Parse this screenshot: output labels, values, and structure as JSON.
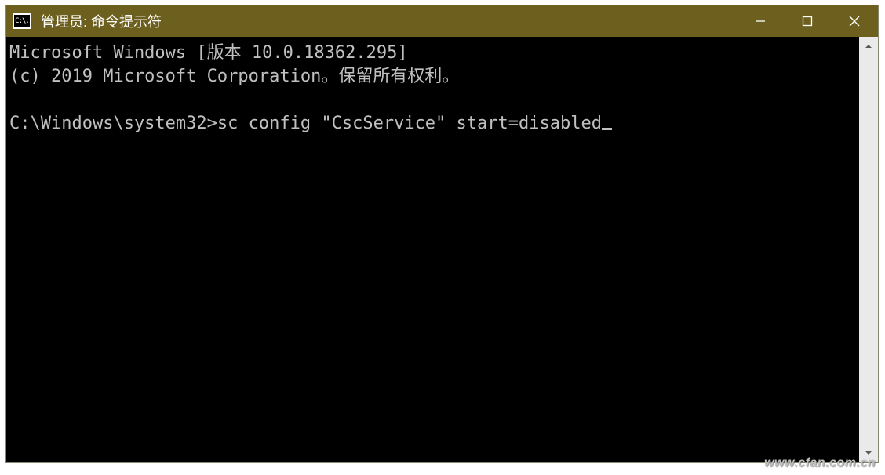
{
  "window": {
    "icon_text": "C:\\.",
    "title": "管理员: 命令提示符"
  },
  "terminal": {
    "line1": "Microsoft Windows [版本 10.0.18362.295]",
    "line2": "(c) 2019 Microsoft Corporation。保留所有权利。",
    "blank": "",
    "prompt": "C:\\Windows\\system32>",
    "command": "sc config \"CscService\" start=disabled"
  },
  "watermark": "www.cfan.com.cn"
}
